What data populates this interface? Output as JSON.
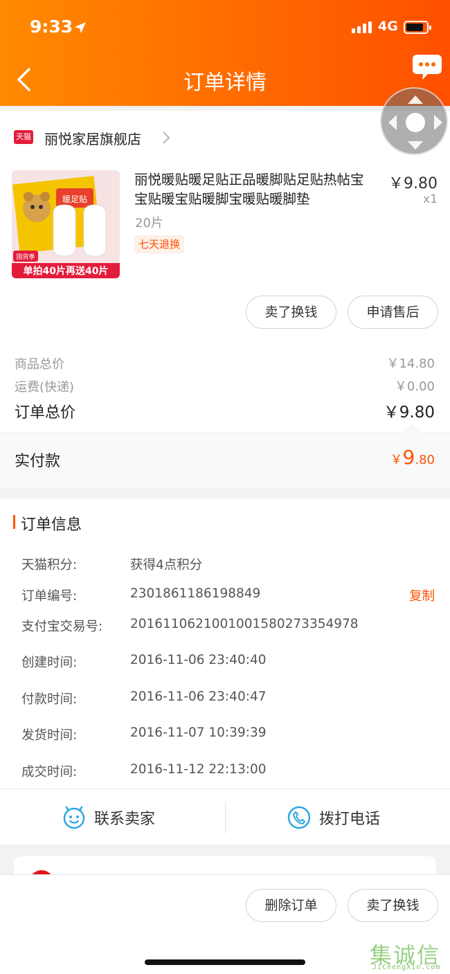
{
  "status_bar": {
    "time": "9:33",
    "network": "4G"
  },
  "nav": {
    "title": "订单详情"
  },
  "shop": {
    "badge": "天猫",
    "name": "丽悦家居旗舰店"
  },
  "product": {
    "title": "丽悦暖贴暖足贴正品暖脚贴足贴热帖宝宝贴暖宝贴暖脚宝暖贴暖脚垫",
    "price": "￥9.80",
    "qty": "x1",
    "spec": "20片",
    "tag": "七天退换",
    "thumb_banner": "单拍40片再送40片",
    "thumb_season": "囤货季",
    "thumb_label": "暖足贴"
  },
  "item_actions": {
    "sell_label": "卖了换钱",
    "after_sale_label": "申请售后"
  },
  "summary": {
    "goods_label": "商品总价",
    "goods_value": "￥14.80",
    "shipping_label": "运费(快递)",
    "shipping_value": "￥0.00",
    "total_label": "订单总价",
    "total_value": "￥9.80",
    "paid_label": "实付款",
    "paid_currency": "￥",
    "paid_int": "9",
    "paid_dec": ".80"
  },
  "order_info": {
    "title": "订单信息",
    "rows": [
      {
        "label": "天猫积分:",
        "value": "获得4点积分"
      },
      {
        "label": "订单编号:",
        "value": "2301861186198849"
      },
      {
        "label": "支付宝交易号:",
        "value": "2016110621001001580273354978"
      },
      {
        "label": "创建时间:",
        "value": "2016-11-06 23:40:40"
      },
      {
        "label": "付款时间:",
        "value": "2016-11-06 23:40:47"
      },
      {
        "label": "发货时间:",
        "value": "2016-11-07 10:39:39"
      },
      {
        "label": "成交时间:",
        "value": "2016-11-12 22:13:00"
      }
    ],
    "copy_label": "复制",
    "contact_seller_label": "联系卖家",
    "call_label": "拨打电话"
  },
  "bottom_bar": {
    "delete_label": "删除订单",
    "sell_label": "卖了换钱"
  },
  "watermark": {
    "chars": "集诚信",
    "url": "JiChengXin.com"
  },
  "colors": {
    "accent": "#ff5000",
    "header_start": "#ff8a00",
    "header_end": "#ff5000",
    "tmall_red": "#e41c3c",
    "link_blue": "#2ea7e0"
  }
}
